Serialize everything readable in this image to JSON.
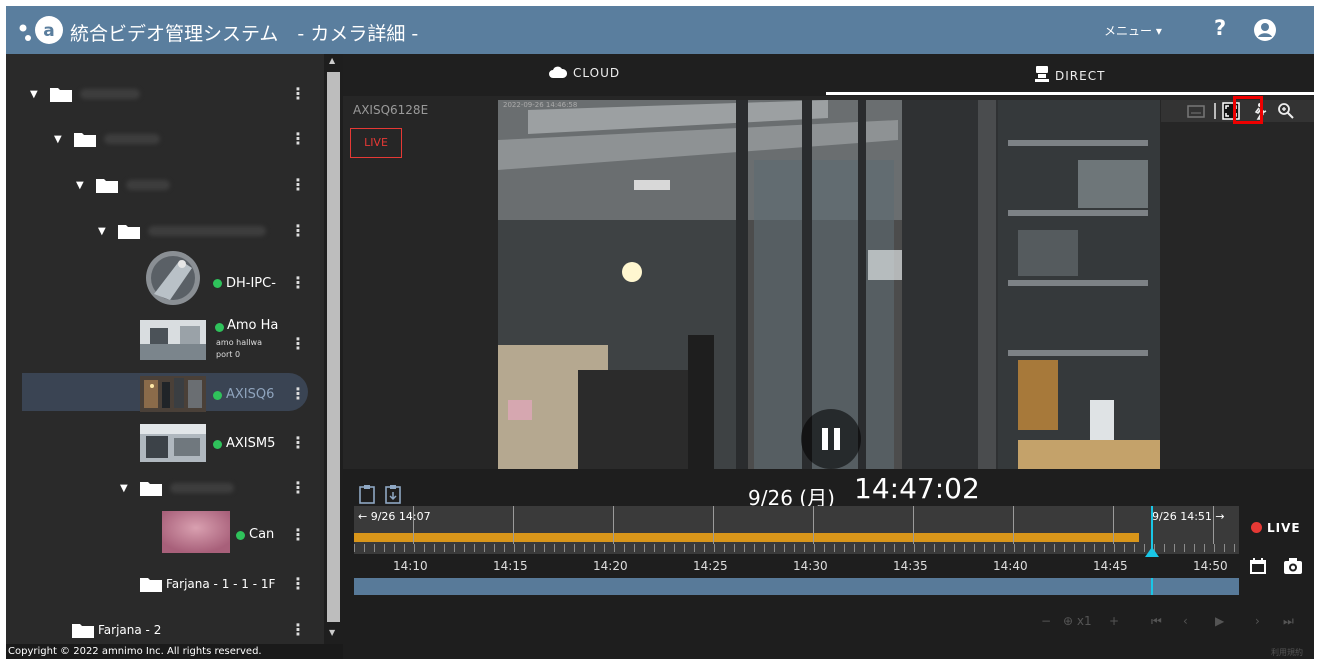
{
  "header": {
    "app_title": "統合ビデオ管理システム　- カメラ詳細 -",
    "menu_label": "メニュー ▾",
    "help_label": "?",
    "bg_color": "#5a7e9e"
  },
  "sidebar": {
    "cameras": [
      {
        "name": "DH-IPC-",
        "sub1": "",
        "sub2": ""
      },
      {
        "name": "Amo Ha",
        "sub1": "amo hallwa",
        "sub2": "port 0"
      },
      {
        "name": "AXISQ6",
        "sub1": "",
        "sub2": ""
      },
      {
        "name": "AXISM5",
        "sub1": "",
        "sub2": ""
      },
      {
        "name": "Can",
        "sub1": "",
        "sub2": ""
      }
    ],
    "folders": [
      "Farjana - 1 - 1 - 1F",
      "Farjana - 2"
    ],
    "dots": "⋮",
    "copyright": "Copyright © 2022 amnimo Inc. All rights reserved."
  },
  "main": {
    "tabs": [
      {
        "label": "CLOUD",
        "icon": "cloud-icon",
        "active": false
      },
      {
        "label": "DIRECT",
        "icon": "camera-icon",
        "active": true
      }
    ],
    "camera_label": "AXISQ6128E",
    "live_badge": "LIVE",
    "video_timestamp": "2022-09-26 14:46:58"
  },
  "timeline": {
    "date": "9/26 (月)",
    "time": "14:47:02",
    "range_start": "← 9/26 14:07",
    "range_end": "9/26 14:51 →",
    "tick_labels": [
      "14:10",
      "14:15",
      "14:20",
      "14:25",
      "14:30",
      "14:35",
      "14:40",
      "14:45",
      "14:50"
    ],
    "live_button": "LIVE",
    "speed": "x1",
    "recorded_color": "#d9961a",
    "cursor_color": "#19c6e6",
    "overview_color": "#587a99"
  },
  "footer": {
    "policy": "利用規約"
  }
}
